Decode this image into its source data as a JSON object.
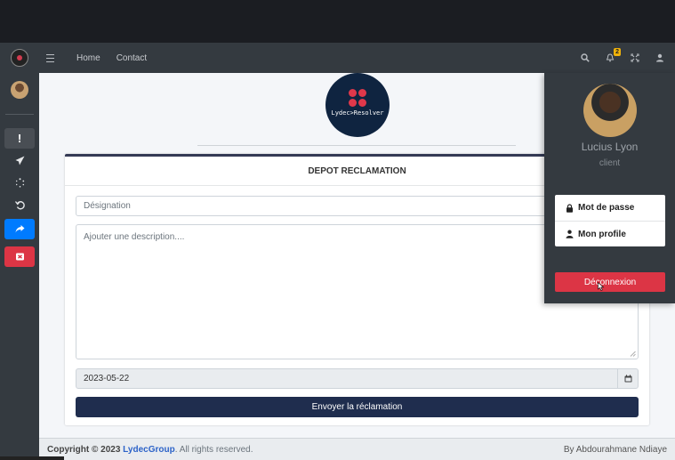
{
  "navbar": {
    "links": [
      "Home",
      "Contact"
    ],
    "notification_count": "2"
  },
  "sidebar": {
    "items": [
      {
        "icon": "exclamation-icon",
        "state": "active"
      },
      {
        "icon": "send-icon",
        "state": "normal"
      },
      {
        "icon": "spinner-icon",
        "state": "normal"
      },
      {
        "icon": "undo-icon",
        "state": "normal"
      },
      {
        "icon": "share-icon",
        "state": "blue"
      },
      {
        "icon": "close-box-icon",
        "state": "red"
      }
    ]
  },
  "logo": {
    "text": "Lydec>Resolver"
  },
  "form": {
    "title": "DEPOT RECLAMATION",
    "designation_placeholder": "Désignation",
    "description_placeholder": "Ajouter une description....",
    "date_value": "2023-05-22",
    "submit_label": "Envoyer la réclamation"
  },
  "user_menu": {
    "name": "Lucius Lyon",
    "role": "client",
    "password_label": "Mot de passe",
    "profile_label": "Mon profile",
    "logout_label": "Déconnexion"
  },
  "footer": {
    "copyright_prefix": "Copyright © 2023",
    "company": "LydecGroup",
    "rights": ". All rights reserved.",
    "author": "By Abdourahmane Ndiaye"
  },
  "colors": {
    "navbar": "#343a40",
    "submit": "#1f2d4e",
    "logout": "#dc3545",
    "share_button": "#007bff",
    "badge": "#f0b20a"
  }
}
